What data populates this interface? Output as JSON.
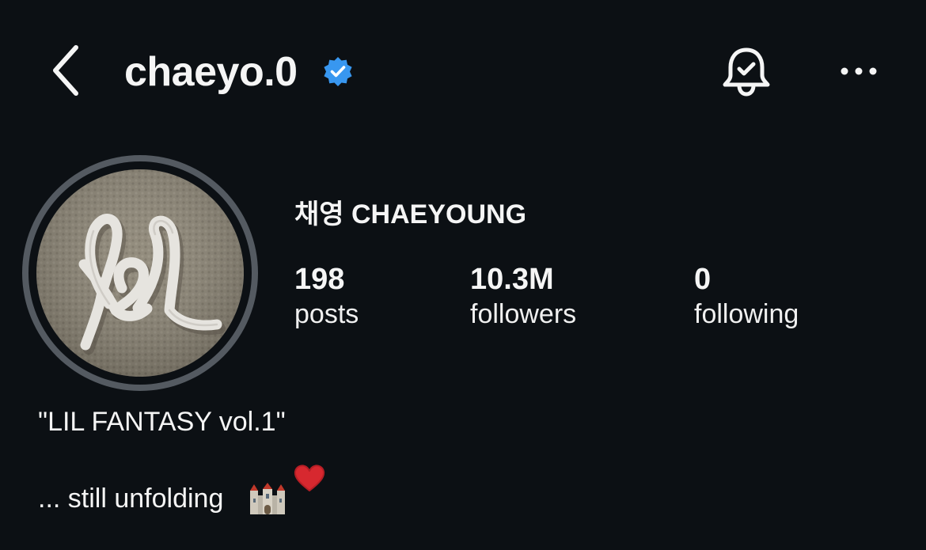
{
  "header": {
    "username": "chaeyo.0",
    "icons": {
      "back": "chevron-left-icon",
      "verified": "verified-badge-icon",
      "notifications": "bell-check-icon",
      "more": "more-horizontal-icon"
    }
  },
  "profile": {
    "display_name": "채영 CHAEYOUNG",
    "avatar": "profile-avatar-ribbon-photo",
    "stats": [
      {
        "count": "198",
        "label": "posts"
      },
      {
        "count": "10.3M",
        "label": "followers"
      },
      {
        "count": "0",
        "label": "following"
      }
    ]
  },
  "bio": {
    "line1": "\"LIL FANTASY vol.1\"",
    "line2": "... still unfolding",
    "emoji": [
      "castle-icon",
      "red-heart-icon"
    ]
  },
  "colors": {
    "background": "#0c1014",
    "text": "#f5f5f5",
    "verified": "#3897f0",
    "avatar_ring": "#545a61",
    "heart": "#d7282f"
  }
}
